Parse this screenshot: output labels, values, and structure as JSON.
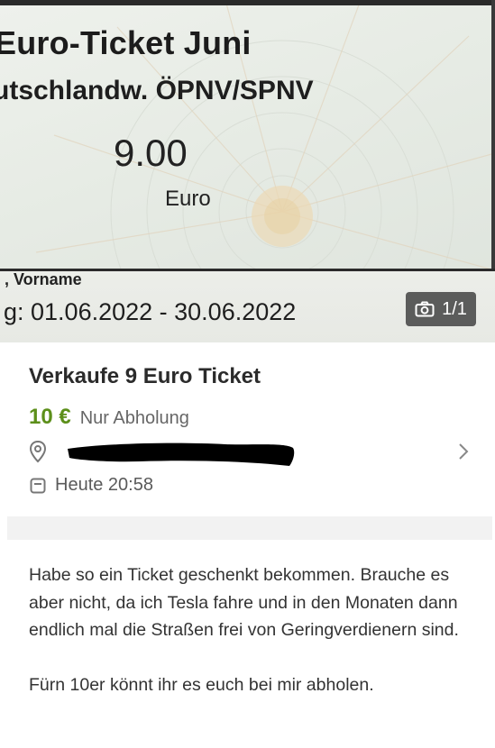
{
  "photo": {
    "ticket_title": "Euro-Ticket Juni",
    "ticket_subtitle": "utschlandw. ÖPNV/SPNV",
    "ticket_price": "9.00",
    "ticket_currency": "Euro",
    "name_label": ", Vorname",
    "validity": "g: 01.06.2022 - 30.06.2022",
    "image_counter": "1/1",
    "counter_icon": "camera-icon"
  },
  "listing": {
    "title": "Verkaufe 9 Euro Ticket",
    "price": "10 €",
    "shipping": "Nur Abholung",
    "location_icon": "location-pin-icon",
    "date_icon": "calendar-icon",
    "posted": "Heute 20:58"
  },
  "description": {
    "paragraph_1": "Habe so ein Ticket geschenkt bekommen. Brauche es aber nicht, da ich Tesla fahre und in den Monaten dann endlich mal die Straßen frei von Geringverdienern sind.",
    "paragraph_2": "Fürn 10er könnt ihr es euch bei mir abholen."
  },
  "colors": {
    "price": "#5c8f1a",
    "text": "#333333",
    "muted": "#666666"
  }
}
